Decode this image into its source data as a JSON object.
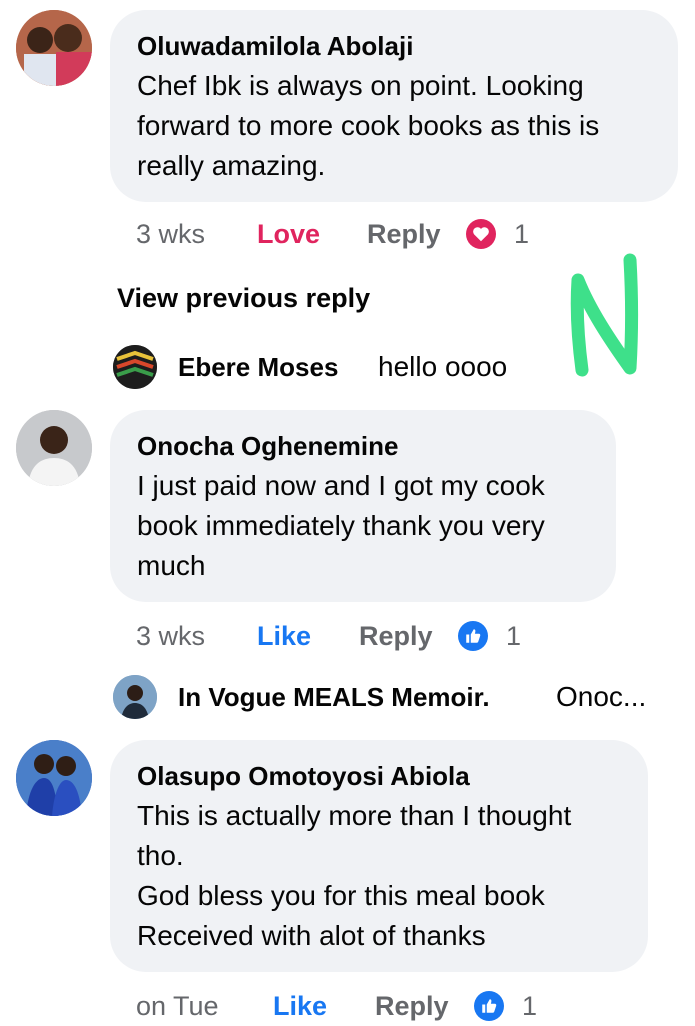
{
  "comments": [
    {
      "author": "Oluwadamilola Abolaji",
      "lines": [
        "Chef Ibk is always on point. Looking",
        "forward to more cook books as this is",
        "really amazing."
      ],
      "time": "3 wks",
      "reaction_label": "Love",
      "reply_label": "Reply",
      "reaction_count": "1",
      "reaction_icon": "heart-icon",
      "reaction_color": "#e0245e"
    },
    {
      "author": "Onocha Oghenemine",
      "lines": [
        "I just paid now and I got my cook",
        "book immediately thank you very",
        "much"
      ],
      "time": "3 wks",
      "reaction_label": "Like",
      "reply_label": "Reply",
      "reaction_count": "1",
      "reaction_icon": "thumbs-up-icon",
      "reaction_color": "#1877f2"
    },
    {
      "author": "Olasupo Omotoyosi Abiola",
      "lines": [
        "This is actually more than I thought",
        "tho.",
        "God bless you for this meal book",
        "Received with alot of thanks"
      ],
      "time": "on Tue",
      "reaction_label": "Like",
      "reply_label": "Reply",
      "reaction_count": "1",
      "reaction_icon": "thumbs-up-icon",
      "reaction_color": "#1877f2"
    }
  ],
  "view_previous_reply": "View previous reply",
  "replies": [
    {
      "author": "Ebere Moses",
      "text": "hello oooo"
    },
    {
      "author": "In Vogue MEALS Memoir.",
      "text": "Onoc..."
    }
  ],
  "annotation": {
    "letter": "N",
    "color": "#3ee08a"
  }
}
